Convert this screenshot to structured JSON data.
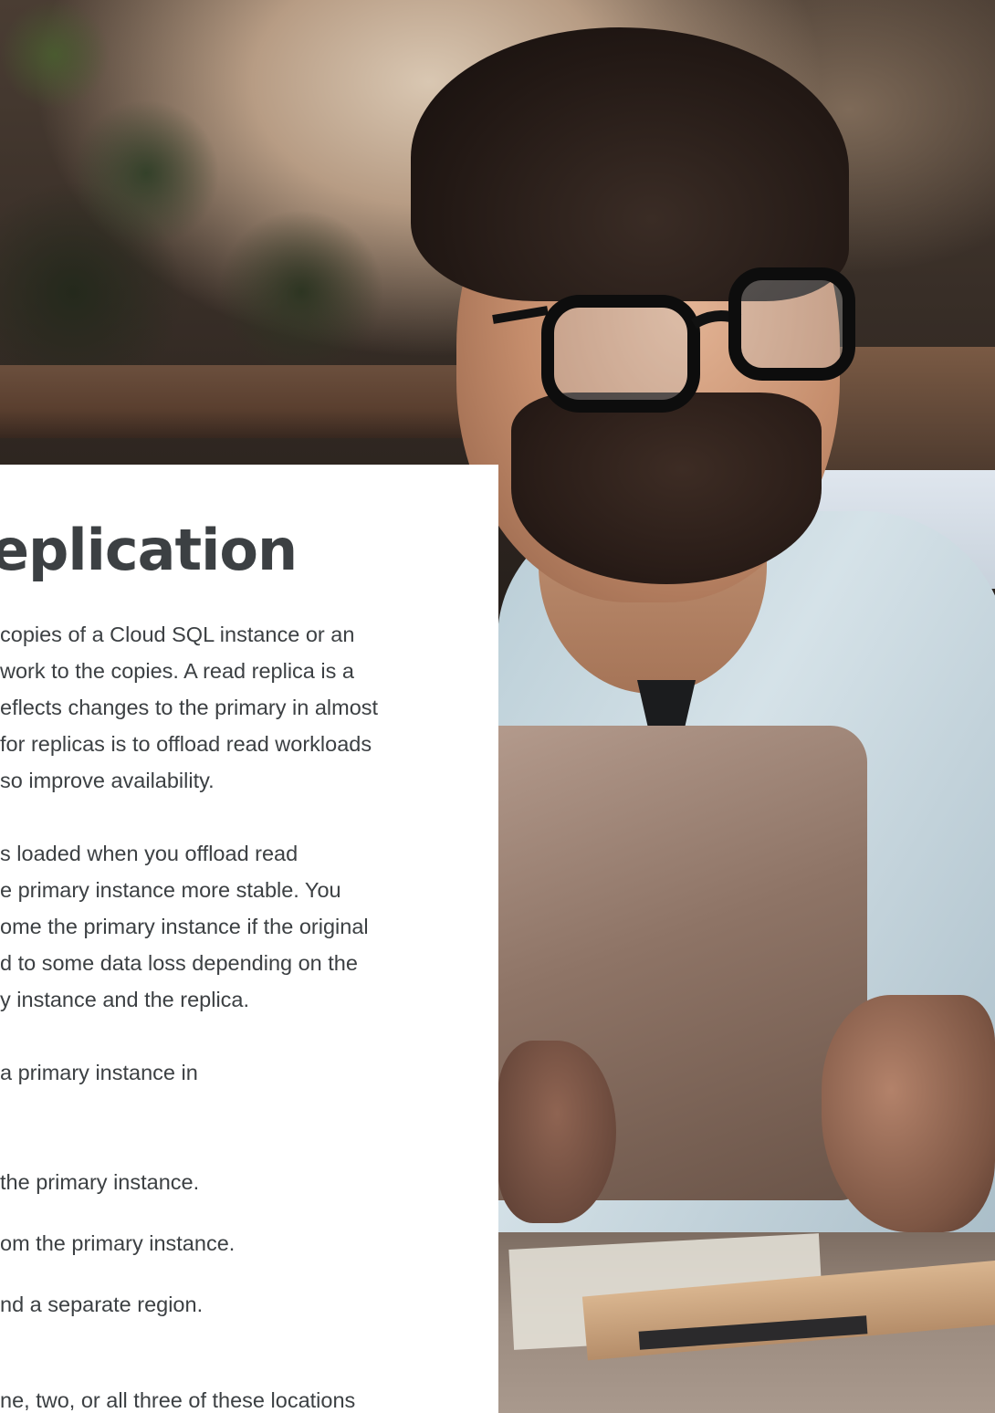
{
  "heading": "eplication",
  "paragraph1": [
    "copies of a Cloud SQL instance or an",
    " work to the copies. A read replica is a",
    "eflects changes to the primary in almost",
    " for replicas is to offload read workloads",
    "so improve availability."
  ],
  "paragraph2": [
    "s loaded when you offload read",
    "e primary instance more stable. You",
    "ome the primary instance if the original",
    "d to some data loss depending on the",
    "y instance and the replica."
  ],
  "paragraph3": [
    "a primary instance in"
  ],
  "list_items": [
    "the primary instance.",
    "om the primary instance.",
    "nd a separate region."
  ],
  "paragraph4": [
    "ne, two, or all three of these locations"
  ]
}
